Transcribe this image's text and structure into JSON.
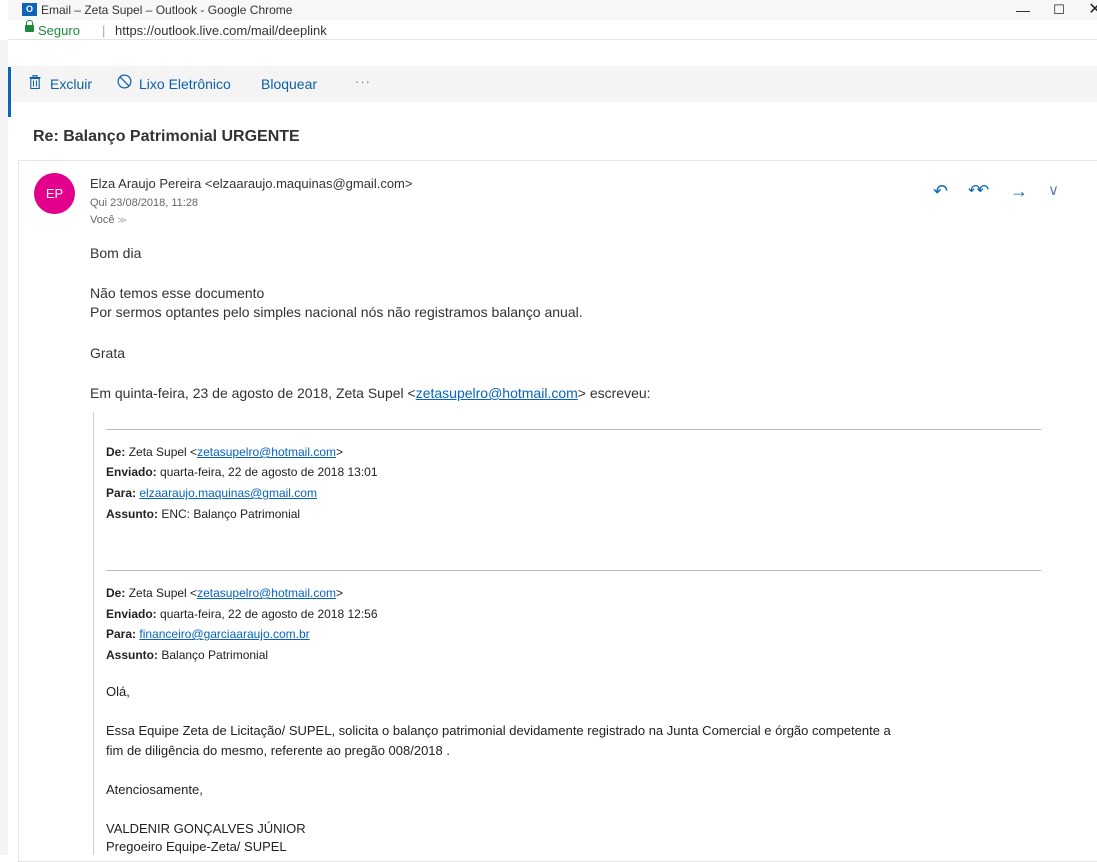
{
  "window": {
    "app_icon_text": "O",
    "title": "Email – Zeta Supel – Outlook - Google Chrome",
    "minimize": "—",
    "maximize": "☐",
    "close": "✕"
  },
  "address_bar": {
    "secure_label": "Seguro",
    "separator": "|",
    "url": "https://outlook.live.com/mail/deeplink"
  },
  "toolbar": {
    "delete_label": "Excluir",
    "junk_label": "Lixo Eletrônico",
    "block_label": "Bloquear",
    "more_label": "···"
  },
  "message": {
    "subject": "Re: Balanço Patrimonial URGENTE",
    "avatar_initials": "EP",
    "sender": "Elza Araujo Pereira <elzaaraujo.maquinas@gmail.com>",
    "date": "Qui 23/08/2018, 11:28",
    "to": "Você",
    "to_chevron": "≫",
    "actions": {
      "reply": "↶",
      "reply_all": "↶↶",
      "forward": "→",
      "more": "∨"
    },
    "body": {
      "greeting": "Bom dia",
      "line1": "Não temos esse documento",
      "line2": "Por sermos optantes pelo simples nacional nós não registramos balanço anual.",
      "closing": "Grata",
      "quote_intro_before": "Em quinta-feira, 23 de agosto de 2018, Zeta Supel <",
      "quote_intro_link": "zetasupelro@hotmail.com",
      "quote_intro_after": "> escreveu:"
    }
  },
  "quoted_1": {
    "from_label": "De:",
    "from_name": "Zeta Supel <",
    "from_email": "zetasupelro@hotmail.com",
    "from_close": ">",
    "sent_label": "Enviado:",
    "sent_value": "quarta-feira, 22 de agosto de 2018 13:01",
    "to_label": "Para:",
    "to_email": "elzaaraujo.maquinas@gmail.com",
    "subject_label": "Assunto:",
    "subject_value": "ENC: Balanço Patrimonial"
  },
  "quoted_2": {
    "from_label": "De:",
    "from_name": "Zeta Supel <",
    "from_email": "zetasupelro@hotmail.com",
    "from_close": ">",
    "sent_label": "Enviado:",
    "sent_value": "quarta-feira, 22 de agosto de 2018 12:56",
    "to_label": "Para:",
    "to_email": "financeiro@garciaaraujo.com.br",
    "subject_label": "Assunto:",
    "subject_value": "Balanço Patrimonial",
    "greeting": "Olá,",
    "para_line1": "Essa Equipe Zeta de Licitação/ SUPEL, solicita o balanço patrimonial devidamente  registrado na Junta Comercial e órgão competente a",
    "para_line2": "fim de diligência do mesmo, referente ao pregão 008/2018 .",
    "signoff": "Atenciosamente,",
    "sig_name": "VALDENIR GONÇALVES JÚNIOR",
    "sig_title": "Pregoeiro Equipe-Zeta/ SUPEL"
  },
  "colors": {
    "accent": "#0f64b7",
    "avatar": "#e3008c",
    "secure": "#1c8a3c",
    "link": "#0563c1"
  },
  "icons": [
    "trash-icon",
    "block-icon",
    "lock-icon",
    "reply-icon",
    "reply-all-icon",
    "forward-icon",
    "expand-chevron-icon"
  ]
}
